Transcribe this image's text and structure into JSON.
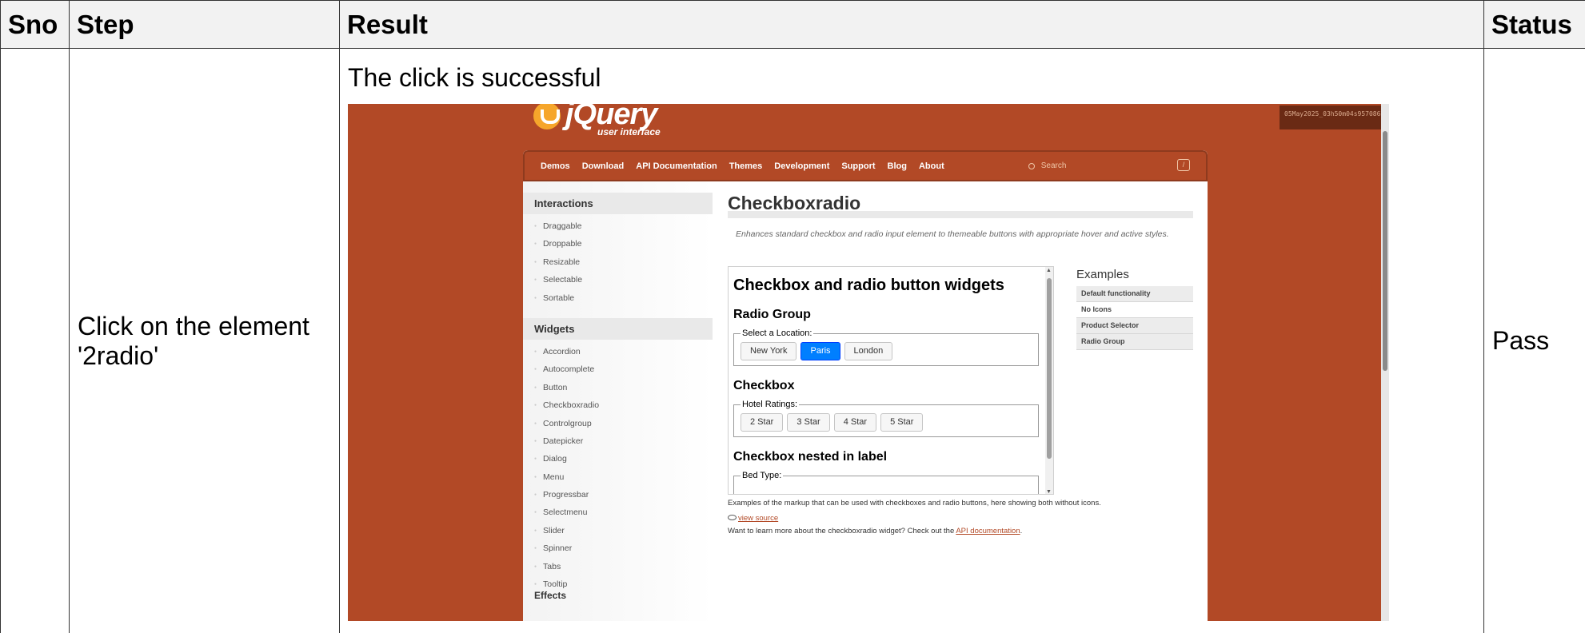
{
  "table": {
    "headers": {
      "sno": "Sno",
      "step": "Step",
      "result": "Result",
      "status": "Status"
    },
    "row": {
      "sno": "",
      "step": "Click on the element '2radio'",
      "result_text": "The click is successful",
      "status": "Pass"
    }
  },
  "screenshot": {
    "logo": {
      "word": "jQuery",
      "sub": "user interface"
    },
    "timestamp": "05May2025_03h50m04s957086",
    "nav": {
      "items": [
        "Demos",
        "Download",
        "API Documentation",
        "Themes",
        "Development",
        "Support",
        "Blog",
        "About"
      ],
      "search_placeholder": "Search",
      "shortcut_key": "/"
    },
    "sidebar": {
      "interactions_heading": "Interactions",
      "interactions": [
        "Draggable",
        "Droppable",
        "Resizable",
        "Selectable",
        "Sortable"
      ],
      "widgets_heading": "Widgets",
      "widgets": [
        "Accordion",
        "Autocomplete",
        "Button",
        "Checkboxradio",
        "Controlgroup",
        "Datepicker",
        "Dialog",
        "Menu",
        "Progressbar",
        "Selectmenu",
        "Slider",
        "Spinner",
        "Tabs",
        "Tooltip"
      ],
      "effects_heading": "Effects"
    },
    "main": {
      "title": "Checkboxradio",
      "description": "Enhances standard checkbox and radio input element to themeable buttons with appropriate hover and active styles.",
      "demo": {
        "heading": "Checkbox and radio button widgets",
        "radio_group": {
          "heading": "Radio Group",
          "legend": "Select a Location:",
          "options": [
            "New York",
            "Paris",
            "London"
          ],
          "selected": "Paris"
        },
        "checkbox": {
          "heading": "Checkbox",
          "legend": "Hotel Ratings:",
          "options": [
            "2 Star",
            "3 Star",
            "4 Star",
            "5 Star"
          ]
        },
        "nested": {
          "heading": "Checkbox nested in label",
          "legend": "Bed Type:"
        }
      },
      "examples": {
        "title": "Examples",
        "items": [
          "Default functionality",
          "No Icons",
          "Product Selector",
          "Radio Group"
        ],
        "selected": "No Icons"
      },
      "markup_note": "Examples of the markup that can be used with checkboxes and radio buttons, here showing both without icons.",
      "view_source": "view source",
      "learn_more_prefix": "Want to learn more about the checkboxradio widget? Check out the ",
      "api_link": "API documentation",
      "learn_more_suffix": "."
    }
  }
}
